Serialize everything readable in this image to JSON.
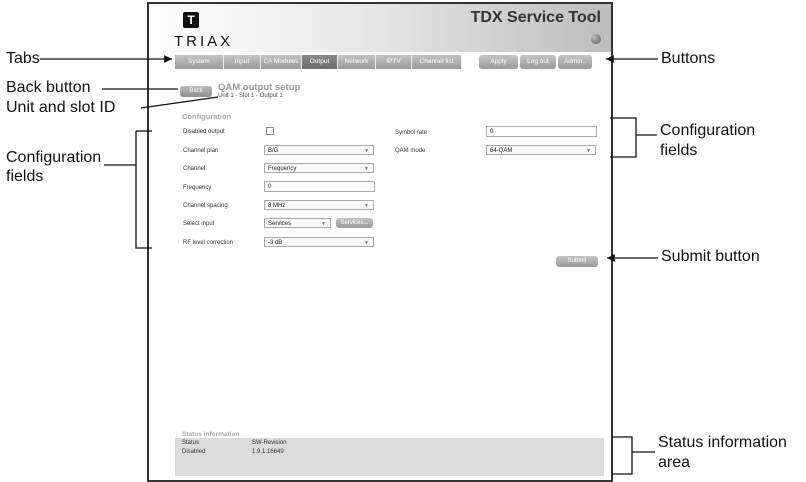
{
  "header": {
    "logo_mark": "T",
    "logo_text": "TRIAX",
    "app_title": "TDX Service Tool"
  },
  "tabs": [
    "System",
    "Input",
    "CA Modules",
    "Output",
    "Network",
    "IPTV",
    "Channel list"
  ],
  "active_tab": "Output",
  "header_buttons": {
    "apply": "Apply",
    "logout": "Log out",
    "admin": "Admin.."
  },
  "page": {
    "back": "Back",
    "title": "QAM  output setup",
    "unit_slot": "Unit 1 - Slot 1 - Output 1"
  },
  "config": {
    "title": "Configuration",
    "disabled_output": {
      "label": "Disabled output",
      "checked": false
    },
    "channel_plan": {
      "label": "Channel plan",
      "value": "B/G"
    },
    "channel": {
      "label": "Channel",
      "value": "Frequency"
    },
    "frequency": {
      "label": "Frequency",
      "value": "0"
    },
    "channel_spacing": {
      "label": "Channel spacing",
      "value": "8 MHz"
    },
    "select_input": {
      "label": "Select input",
      "value": "Services",
      "button": "Services..."
    },
    "rf_level": {
      "label": "RF level correction",
      "value": "-3 dB"
    },
    "symbol_rate": {
      "label": "Symbol rate",
      "value": "0"
    },
    "qam_mode": {
      "label": "QAM mode",
      "value": "64-QAM"
    }
  },
  "submit": "Submit",
  "status": {
    "title": "Status information",
    "col1_header": "Status",
    "col2_header": "SW-Revision",
    "col1_value": "Disabled",
    "col2_value": "1.9.1.16649"
  },
  "annotations": {
    "tabs": "Tabs",
    "back_button": "Back button",
    "unit_slot": "Unit and slot ID",
    "config_left_1": "Configuration",
    "config_left_2": "fields",
    "buttons": "Buttons",
    "config_right_1": "Configuration",
    "config_right_2": "fields",
    "submit": "Submit button",
    "status_1": "Status information",
    "status_2": "area"
  }
}
